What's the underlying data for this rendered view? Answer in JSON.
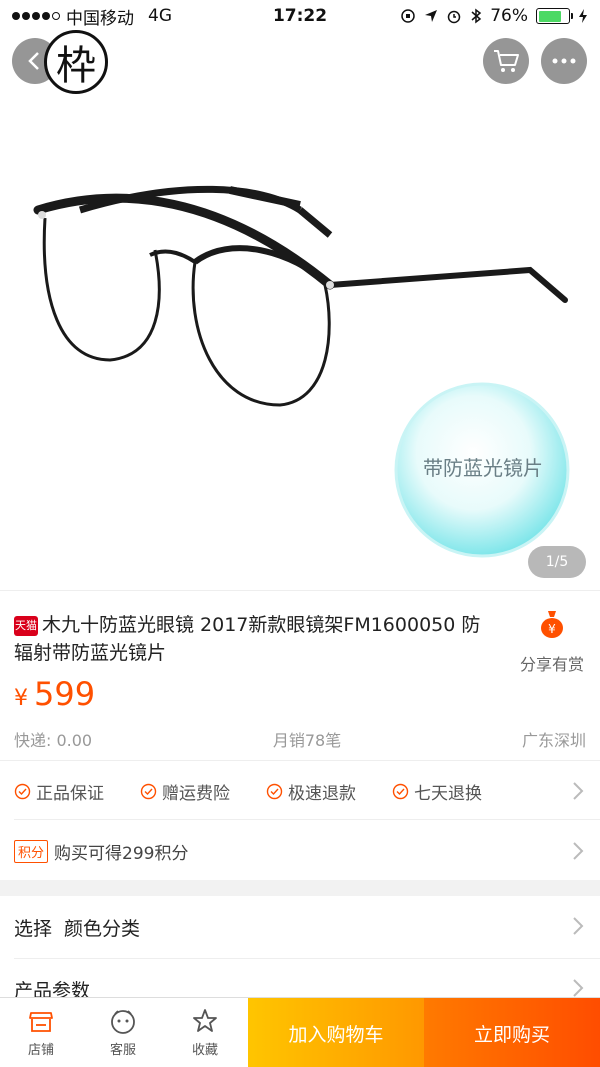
{
  "status_bar": {
    "carrier": "中国移动",
    "network": "4G",
    "time": "17:22",
    "battery": "76%",
    "battery_level": 0.76
  },
  "header": {
    "brand_logo_char": "枠",
    "back_icon": "chevron-left-icon",
    "cart_icon": "cart-icon",
    "more_icon": "more-dots-icon"
  },
  "gallery": {
    "lens_label": "带防蓝光镜片",
    "page_indicator": "1/5"
  },
  "product": {
    "badge": "天猫",
    "title": "木九十防蓝光眼镜 2017新款眼镜架FM1600050 防辐射带防蓝光镜片",
    "share_label": "分享有赏",
    "price_currency": "¥",
    "price": "599",
    "shipping": "快递: 0.00",
    "monthly_sales": "月销78笔",
    "location": "广东深圳"
  },
  "guarantees": {
    "items": [
      "正品保证",
      "赠运费险",
      "极速退款",
      "七天退换"
    ],
    "points_badge": "积分",
    "points_text": "购买可得299积分"
  },
  "specs": {
    "select_label": "选择",
    "select_value": "颜色分类",
    "params_label": "产品参数"
  },
  "bottom_bar": {
    "tabs": [
      {
        "label": "店铺",
        "icon": "store-icon"
      },
      {
        "label": "客服",
        "icon": "customer-service-icon"
      },
      {
        "label": "收藏",
        "icon": "star-icon"
      }
    ],
    "add_to_cart": "加入购物车",
    "buy_now": "立即购买"
  },
  "colors": {
    "accent": "#ff5000",
    "cart_button": "#ffb400",
    "buy_button": "#ff5a00"
  }
}
